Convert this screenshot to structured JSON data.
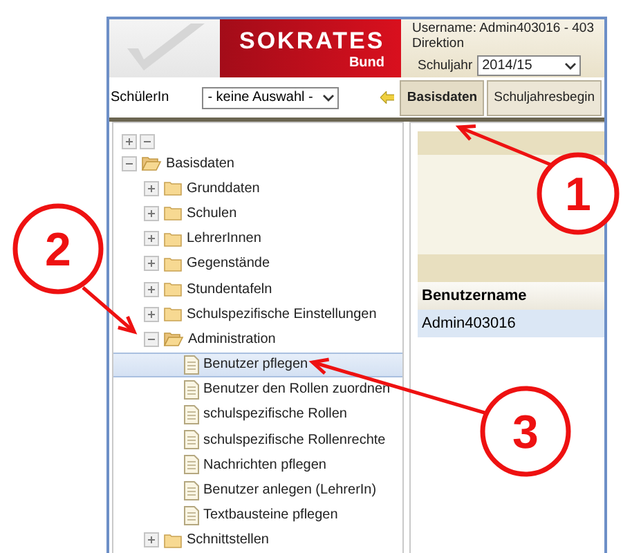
{
  "header": {
    "logo": {
      "title": "SOKRATES",
      "subtitle": "Bund"
    },
    "username": "Username: Admin403016 - 403",
    "role": "Direktion",
    "school_year": {
      "label": "Schuljahr",
      "value": "2014/15"
    }
  },
  "toolbar": {
    "student_label": "SchülerIn",
    "student_select": "- keine Auswahl -",
    "tabs": [
      {
        "label": "Basisdaten",
        "selected": true
      },
      {
        "label": "Schuljahresbegin",
        "selected": false
      }
    ]
  },
  "tree": [
    {
      "label": "Basisdaten",
      "kind": "folder",
      "expanded": true,
      "selected": false,
      "children": [
        {
          "label": "Grunddaten",
          "kind": "folder",
          "expanded": false,
          "selected": false
        },
        {
          "label": "Schulen",
          "kind": "folder",
          "expanded": false,
          "selected": false
        },
        {
          "label": "LehrerInnen",
          "kind": "folder",
          "expanded": false,
          "selected": false
        },
        {
          "label": "Gegenstände",
          "kind": "folder",
          "expanded": false,
          "selected": false
        },
        {
          "label": "Stundentafeln",
          "kind": "folder",
          "expanded": false,
          "selected": false
        },
        {
          "label": "Schulspezifische Einstellungen",
          "kind": "folder",
          "expanded": false,
          "selected": false
        },
        {
          "label": "Administration",
          "kind": "folder",
          "expanded": true,
          "selected": false,
          "children": [
            {
              "label": "Benutzer pflegen",
              "kind": "page",
              "selected": true
            },
            {
              "label": "Benutzer den Rollen zuordnen",
              "kind": "page",
              "selected": false
            },
            {
              "label": "schulspezifische Rollen",
              "kind": "page",
              "selected": false
            },
            {
              "label": "schulspezifische Rollenrechte",
              "kind": "page",
              "selected": false
            },
            {
              "label": "Nachrichten pflegen",
              "kind": "page",
              "selected": false
            },
            {
              "label": "Benutzer anlegen (LehrerIn)",
              "kind": "page",
              "selected": false
            },
            {
              "label": "Textbausteine pflegen",
              "kind": "page",
              "selected": false
            }
          ]
        },
        {
          "label": "Schnittstellen",
          "kind": "folder",
          "expanded": false,
          "selected": false
        }
      ]
    }
  ],
  "table": {
    "columns": [
      "Benutzername"
    ],
    "rows": [
      {
        "cells": [
          "Admin403016"
        ],
        "selected": true
      }
    ]
  },
  "annotations": [
    {
      "label": "1"
    },
    {
      "label": "2"
    },
    {
      "label": "3"
    }
  ]
}
